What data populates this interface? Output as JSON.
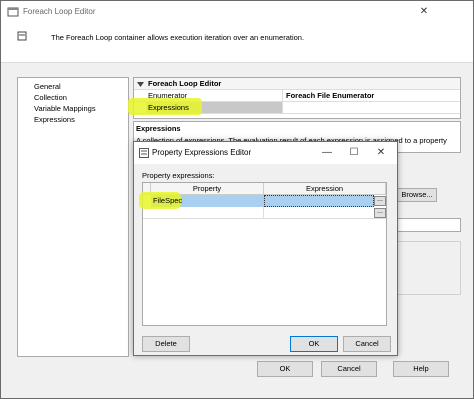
{
  "outer_window": {
    "title": "Foreach Loop Editor",
    "description": "The Foreach Loop container allows execution iteration over an enumeration.",
    "nav": [
      "General",
      "Collection",
      "Variable Mappings",
      "Expressions"
    ],
    "grid": {
      "header": "Foreach Loop Editor",
      "rows": [
        {
          "label": "Enumerator",
          "value": "Foreach File Enumerator"
        },
        {
          "label": "Expressions",
          "value": ""
        }
      ]
    },
    "explanation": {
      "title": "Expressions",
      "text": "A collection of expressions. The evaluation result of each expression is assigned to a property"
    },
    "browse_label": "Browse...",
    "ok": "OK",
    "cancel": "Cancel",
    "help": "Help",
    "controls": {
      "min": "—",
      "max": "☐",
      "close": "✕"
    }
  },
  "inner_dialog": {
    "title": "Property Expressions Editor",
    "label": "Property expressions:",
    "columns": [
      "Property",
      "Expression"
    ],
    "rows": [
      {
        "property": "FileSpec",
        "expression": ""
      },
      {
        "property": "",
        "expression": ""
      }
    ],
    "ellipsis": "...",
    "delete": "Delete",
    "ok": "OK",
    "cancel": "Cancel",
    "controls": {
      "min": "—",
      "max": "☐",
      "close": "✕"
    }
  }
}
